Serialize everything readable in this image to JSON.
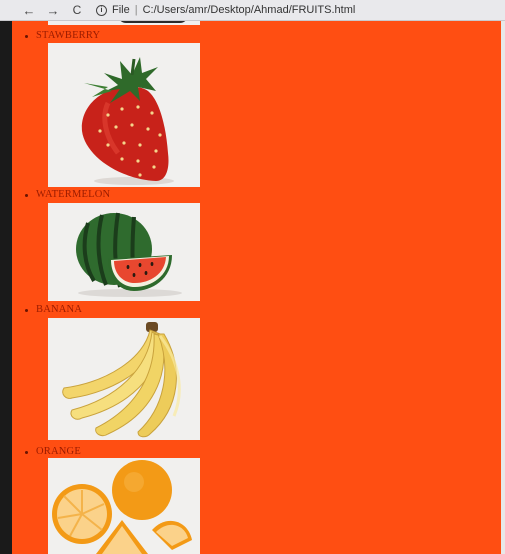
{
  "browser": {
    "back_icon": "←",
    "forward_icon": "→",
    "reload_icon": "C",
    "file_label": "File",
    "separator": "|",
    "url": "C:/Users/amr/Desktop/Ahmad/FRUITS.html"
  },
  "fruits": [
    {
      "label": "STAWBERRY",
      "image": "strawberry-image"
    },
    {
      "label": "WATERMELON",
      "image": "watermelon-image"
    },
    {
      "label": "BANANA",
      "image": "banana-image"
    },
    {
      "label": "ORANGE",
      "image": "orange-image"
    }
  ],
  "colors": {
    "page_background": "#ff4e12",
    "label_text": "#9b1c00"
  }
}
